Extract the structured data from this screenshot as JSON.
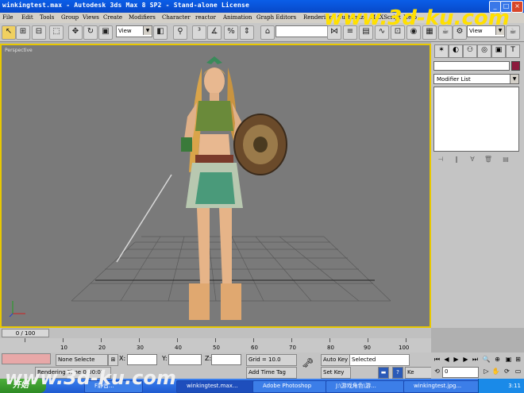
{
  "window": {
    "title": "winkingtest.max - Autodesk 3ds Max 8 SP2  - Stand-alone License",
    "controls": [
      "_",
      "□",
      "×"
    ]
  },
  "menu": [
    "File",
    "Edit",
    "Tools",
    "Group",
    "Views",
    "Create",
    "Modifiers",
    "Character",
    "reactor",
    "Animation",
    "Graph Editors",
    "Rendering",
    "Customize",
    "MAXScript",
    "Help"
  ],
  "toolbar": {
    "ref_coord": "View",
    "render_view": "View",
    "named_sel": ""
  },
  "viewport": {
    "label": "Perspective",
    "border_color": "#e8c800",
    "bg_color": "#7a7a7a"
  },
  "command_panel": {
    "modifier_list": "Modifier List",
    "object_color": "#8c1a3c"
  },
  "timeline": {
    "frame": "0 / 100",
    "ticks": [
      "10",
      "20",
      "30",
      "40",
      "50",
      "60",
      "70",
      "80",
      "90",
      "100"
    ]
  },
  "status": {
    "selection": "None Selecte",
    "x_label": "X:",
    "y_label": "Y:",
    "z_label": "Z:",
    "grid": "Grid = 10.0",
    "add_time_tag": "Add Time Tag",
    "auto_key": "Auto Key",
    "key_mode": "Selected",
    "set_key": "Set Key",
    "key_filter": "Ke",
    "rendering_time": "Rendering Time 0:00:03",
    "frame_field": "0"
  },
  "taskbar": {
    "start": "开始",
    "tasks": [
      {
        "label": "F静音..."
      },
      {
        "label": "winkingtest.max..."
      },
      {
        "label": "Adobe Photoshop"
      },
      {
        "label": "J:\\游戏角色\\游..."
      },
      {
        "label": "winkingtest.jpg..."
      }
    ],
    "clock": "3:11"
  },
  "watermarks": {
    "top": "www.3d-ku.com",
    "bottom": "www.3d-ku.com"
  }
}
